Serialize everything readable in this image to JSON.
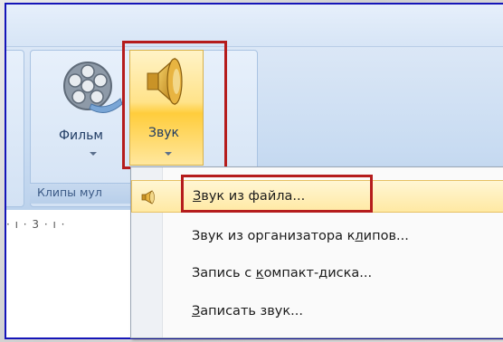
{
  "ribbon": {
    "group_label": "Клипы мул",
    "film_button": {
      "label": "Фильм",
      "icon": "film-reel-icon"
    },
    "sound_button": {
      "label": "Звук",
      "icon": "speaker-icon"
    }
  },
  "ruler": {
    "text": "· ı · 3 · ı ·"
  },
  "sound_menu": {
    "items": [
      {
        "underline": "З",
        "rest": "вук из файла...",
        "icon": "speaker-small-icon",
        "highlighted": true
      },
      {
        "pre": "Звук из организатора к",
        "underline": "л",
        "rest": "ипов..."
      },
      {
        "pre": "Запись с ",
        "underline": "к",
        "rest": "омпакт-диска..."
      },
      {
        "underline": "З",
        "rest": "аписать звук..."
      }
    ]
  },
  "colors": {
    "frame_border": "#1515b8",
    "highlight_border": "#b51c1c",
    "hover_fill": "#ffe38a"
  }
}
